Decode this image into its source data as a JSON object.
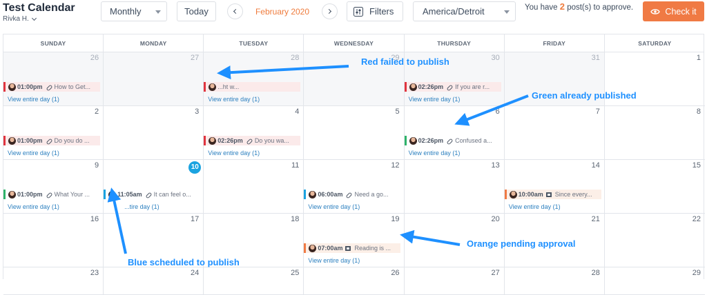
{
  "app": {
    "title": "Test Calendar",
    "user": "Rivka H."
  },
  "toolbar": {
    "view": "Monthly",
    "today": "Today",
    "month": "February 2020",
    "filters": "Filters",
    "timezone": "America/Detroit",
    "approve_prefix": "You have",
    "approve_count": "2",
    "approve_suffix": "post(s) to approve.",
    "check_button": "Check it"
  },
  "colors": {
    "failed": "#e0343f",
    "published": "#2fb36a",
    "scheduled": "#1ba3e0",
    "pending": "#f07a44",
    "accent": "#ef7b3c"
  },
  "calendar": {
    "weekdays": [
      "SUNDAY",
      "MONDAY",
      "TUESDAY",
      "WEDNESDAY",
      "THURSDAY",
      "FRIDAY",
      "SATURDAY"
    ],
    "view_day_label": "View entire day (1)",
    "today_date": "10",
    "weeks": [
      [
        "26",
        "27",
        "28",
        "29",
        "30",
        "31",
        "1"
      ],
      [
        "2",
        "3",
        "4",
        "5",
        "6",
        "7",
        "8"
      ],
      [
        "9",
        "10",
        "11",
        "12",
        "13",
        "14",
        "15"
      ],
      [
        "16",
        "17",
        "18",
        "19",
        "20",
        "21",
        "22"
      ],
      [
        "23",
        "24",
        "25",
        "26",
        "27",
        "28",
        "29"
      ]
    ],
    "posts": [
      {
        "week": 0,
        "day": 0,
        "time": "01:00pm",
        "kind": "link",
        "title": "How to Get...",
        "status": "failed"
      },
      {
        "week": 0,
        "day": 2,
        "time": "",
        "kind": "link",
        "title": "...ht w...",
        "status": "failed"
      },
      {
        "week": 0,
        "day": 4,
        "time": "02:26pm",
        "kind": "link",
        "title": "If you are r...",
        "status": "failed"
      },
      {
        "week": 1,
        "day": 0,
        "time": "01:00pm",
        "kind": "link",
        "title": "Do you do ...",
        "status": "failed"
      },
      {
        "week": 1,
        "day": 2,
        "time": "02:26pm",
        "kind": "link",
        "title": "Do you wa...",
        "status": "failed"
      },
      {
        "week": 1,
        "day": 4,
        "time": "02:26pm",
        "kind": "link",
        "title": "Confused a...",
        "status": "published"
      },
      {
        "week": 2,
        "day": 0,
        "time": "01:00pm",
        "kind": "link",
        "title": "What Your ...",
        "status": "published"
      },
      {
        "week": 2,
        "day": 1,
        "time": "11:05am",
        "kind": "link",
        "title": "It can feel o...",
        "status": "scheduled"
      },
      {
        "week": 2,
        "day": 3,
        "time": "06:00am",
        "kind": "link",
        "title": "Need a go...",
        "status": "scheduled"
      },
      {
        "week": 2,
        "day": 5,
        "time": "10:00am",
        "kind": "image",
        "title": "Since every...",
        "status": "pending"
      },
      {
        "week": 3,
        "day": 3,
        "time": "07:00am",
        "kind": "image",
        "title": "Reading is ...",
        "status": "pending"
      }
    ],
    "view_links": [
      {
        "week": 0,
        "day": 0,
        "label": "View entire day (1)"
      },
      {
        "week": 0,
        "day": 2,
        "label": "View entire day (1)"
      },
      {
        "week": 0,
        "day": 4,
        "label": "View entire day (1)"
      },
      {
        "week": 1,
        "day": 0,
        "label": "View entire day (1)"
      },
      {
        "week": 1,
        "day": 2,
        "label": "View entire day (1)"
      },
      {
        "week": 1,
        "day": 4,
        "label": "View entire day (1)"
      },
      {
        "week": 2,
        "day": 0,
        "label": "View entire day (1)"
      },
      {
        "week": 2,
        "day": 1,
        "label": "...tire day (1)"
      },
      {
        "week": 2,
        "day": 3,
        "label": "View entire day (1)"
      },
      {
        "week": 2,
        "day": 5,
        "label": "View entire day (1)"
      },
      {
        "week": 3,
        "day": 3,
        "label": "View entire day (1)"
      }
    ]
  },
  "annotations": {
    "red": "Red failed to publish",
    "green": "Green already published",
    "blue": "Blue scheduled to publish",
    "orange": "Orange pending approval"
  }
}
